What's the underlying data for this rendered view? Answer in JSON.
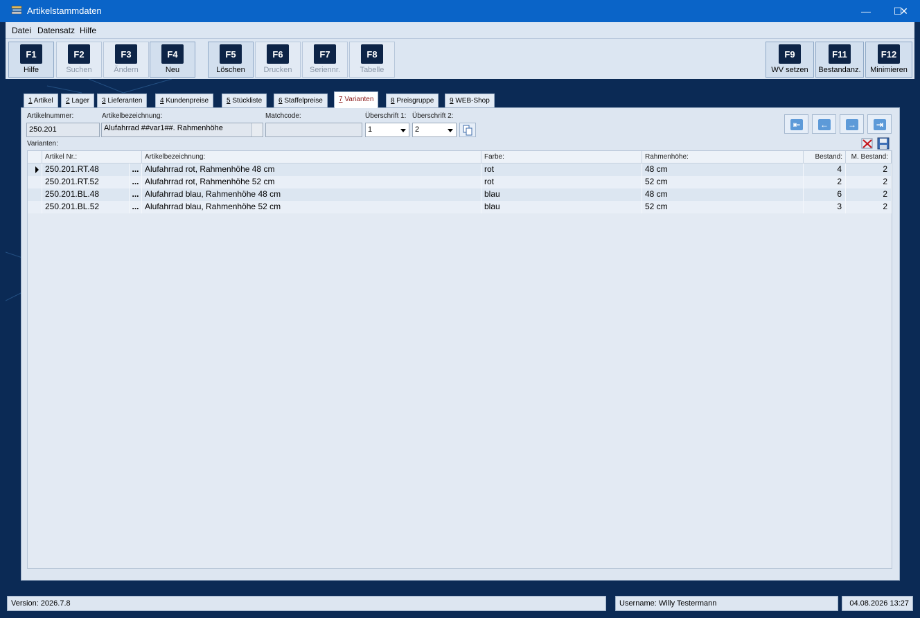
{
  "window": {
    "title": "Artikelstammdaten",
    "minimize": "—",
    "maximize": "☐",
    "close": "✕"
  },
  "menu": [
    "Datei",
    "Datensatz",
    "Hilfe"
  ],
  "toolbar": [
    {
      "key": "F1",
      "label": "Hilfe",
      "enabled": true
    },
    {
      "key": "F2",
      "label": "Suchen",
      "enabled": false
    },
    {
      "key": "F3",
      "label": "Ändern",
      "enabled": false
    },
    {
      "key": "F4",
      "label": "Neu",
      "enabled": true
    },
    {
      "key": "F5",
      "label": "Löschen",
      "enabled": true
    },
    {
      "key": "F6",
      "label": "Drucken",
      "enabled": false
    },
    {
      "key": "F7",
      "label": "Seriennr.",
      "enabled": false
    },
    {
      "key": "F8",
      "label": "Tabelle",
      "enabled": false
    },
    {
      "key": "F9",
      "label": "WV setzen",
      "enabled": true
    },
    {
      "key": "F11",
      "label": "Bestandanz.",
      "enabled": true
    },
    {
      "key": "F12",
      "label": "Minimieren",
      "enabled": true
    }
  ],
  "tabs": [
    {
      "num": "1",
      "label": "Artikel"
    },
    {
      "num": "2",
      "label": "Lager"
    },
    {
      "num": "3",
      "label": "Lieferanten"
    },
    {
      "num": "4",
      "label": "Kundenpreise"
    },
    {
      "num": "5",
      "label": "Stückliste"
    },
    {
      "num": "6",
      "label": "Staffelpreise"
    },
    {
      "num": "7",
      "label": "Varianten",
      "active": true
    },
    {
      "num": "8",
      "label": "Preisgruppe"
    },
    {
      "num": "9",
      "label": "WEB-Shop"
    }
  ],
  "form": {
    "artikelnummer_label": "Artikelnummer:",
    "artikelnummer_value": "250.201",
    "artikelbezeichnung_label": "Artikelbezeichnung:",
    "artikelbezeichnung_value": "Alufahrrad ##var1##. Rahmenhöhe",
    "matchcode_label": "Matchcode:",
    "matchcode_value": "",
    "ueberschrift1_label": "Überschrift 1:",
    "ueberschrift1_value": "1",
    "ueberschrift2_label": "Überschrift 2:",
    "ueberschrift2_value": "2",
    "varianten_label": "Varianten:"
  },
  "nav": {
    "first": "⇤",
    "prev": "←",
    "next": "→",
    "last": "⇥"
  },
  "grid": {
    "columns": [
      "Artikel Nr.:",
      "Artikelbezeichnung:",
      "Farbe:",
      "Rahmenhöhe:",
      "Bestand:",
      "M. Bestand:"
    ],
    "dots": "...",
    "rows": [
      {
        "nr": "250.201.RT.48",
        "bez": "Alufahrrad rot, Rahmenhöhe 48 cm",
        "farbe": "rot",
        "rahmen": "48 cm",
        "bestand": "4",
        "mbestand": "2"
      },
      {
        "nr": "250.201.RT.52",
        "bez": "Alufahrrad rot, Rahmenhöhe 52 cm",
        "farbe": "rot",
        "rahmen": "52 cm",
        "bestand": "2",
        "mbestand": "2"
      },
      {
        "nr": "250.201.BL.48",
        "bez": "Alufahrrad blau, Rahmenhöhe 48 cm",
        "farbe": "blau",
        "rahmen": "48 cm",
        "bestand": "6",
        "mbestand": "2"
      },
      {
        "nr": "250.201.BL.52",
        "bez": "Alufahrrad blau, Rahmenhöhe 52 cm",
        "farbe": "blau",
        "rahmen": "52 cm",
        "bestand": "3",
        "mbestand": "2"
      }
    ]
  },
  "status": {
    "version": "Version: 2026.7.8",
    "user": "Username: Willy Testermann",
    "datetime": "04.08.2026 13:27"
  }
}
